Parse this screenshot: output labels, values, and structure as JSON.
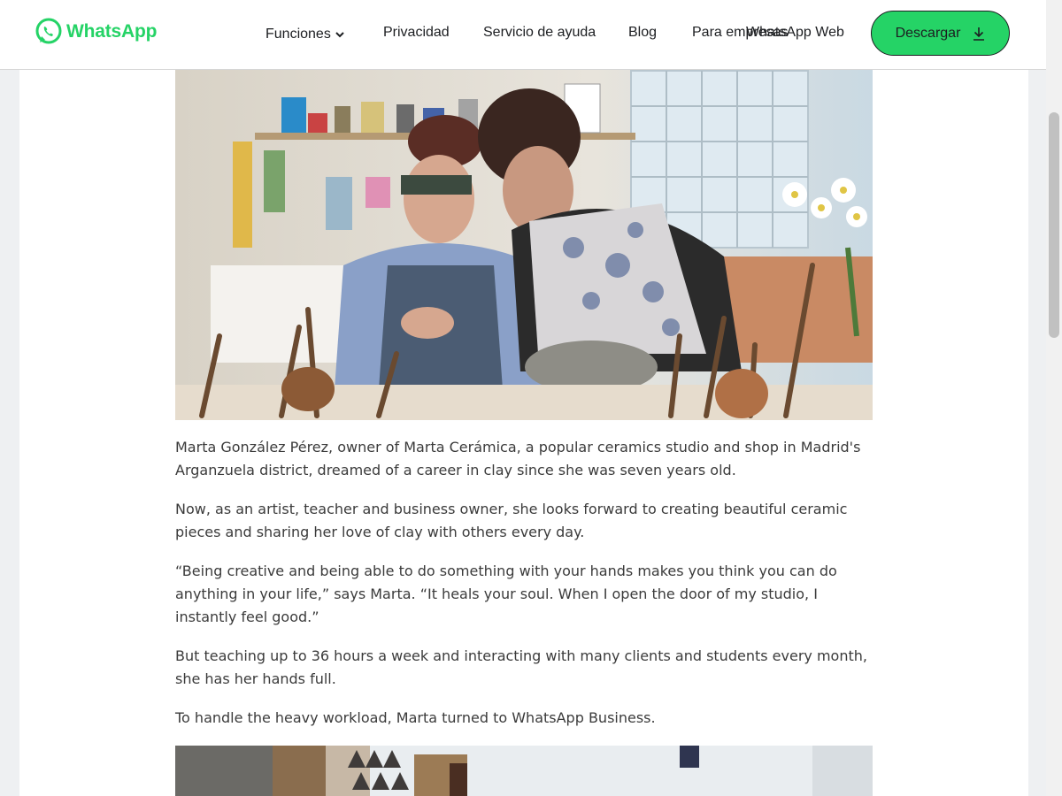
{
  "header": {
    "brand": "WhatsApp",
    "brand_color": "#25d366",
    "nav": {
      "funciones": "Funciones",
      "privacidad": "Privacidad",
      "servicio": "Servicio de ayuda",
      "blog": "Blog",
      "empresas": "Para empresas",
      "web": "WhatsApp Web"
    },
    "download_label": "Descargar",
    "icons": [
      "whatsapp-logo-icon",
      "chevron-down-icon",
      "download-arrow-icon"
    ]
  },
  "article": {
    "paragraphs": [
      "Marta González Pérez, owner of Marta Cerámica, a popular ceramics studio and shop in Madrid's Arganzuela district, dreamed of a career in clay since she was seven years old.",
      "Now, as an artist, teacher and business owner, she looks forward to creating beautiful ceramic pieces and sharing her love of clay with others every day.",
      "“Being creative and being able to do something with your hands makes you think you can do anything in your life,” says Marta. “It heals your soul. When I open the door of my studio, I instantly feel good.”",
      "But teaching up to 36 hours a week and interacting with many clients and students every month, she has her hands full.",
      "To handle the heavy workload, Marta turned to WhatsApp Business."
    ]
  },
  "images": {
    "top": "ceramics-studio-photo",
    "bottom": "studio-shelves-photo"
  }
}
